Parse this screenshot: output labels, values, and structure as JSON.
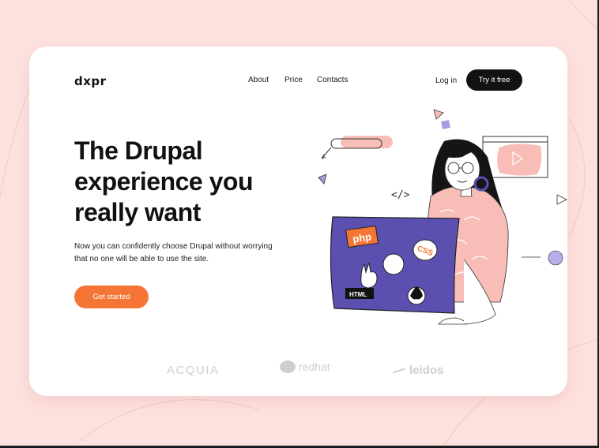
{
  "header": {
    "logo": "dxpr",
    "nav": [
      {
        "label": "About"
      },
      {
        "label": "Price"
      },
      {
        "label": "Contacts"
      }
    ],
    "login_label": "Log in",
    "cta_label": "Try it free"
  },
  "hero": {
    "title_lines": [
      "The Drupal",
      "experience you",
      "really want"
    ],
    "subtitle": "Now you can confidently choose Drupal without worrying that no one will be able to use the site.",
    "button_label": "Get started"
  },
  "illustration": {
    "stickers": {
      "php": "php",
      "css": "CSS",
      "html": "HTML"
    },
    "code_glyph": "</>"
  },
  "partners": [
    {
      "name": "ACQUIA"
    },
    {
      "name": "redhat"
    },
    {
      "name": "leidos"
    }
  ],
  "colors": {
    "background": "#fde1de",
    "accent_orange": "#f57534",
    "laptop_purple": "#5b4fb0",
    "dark": "#121212"
  }
}
